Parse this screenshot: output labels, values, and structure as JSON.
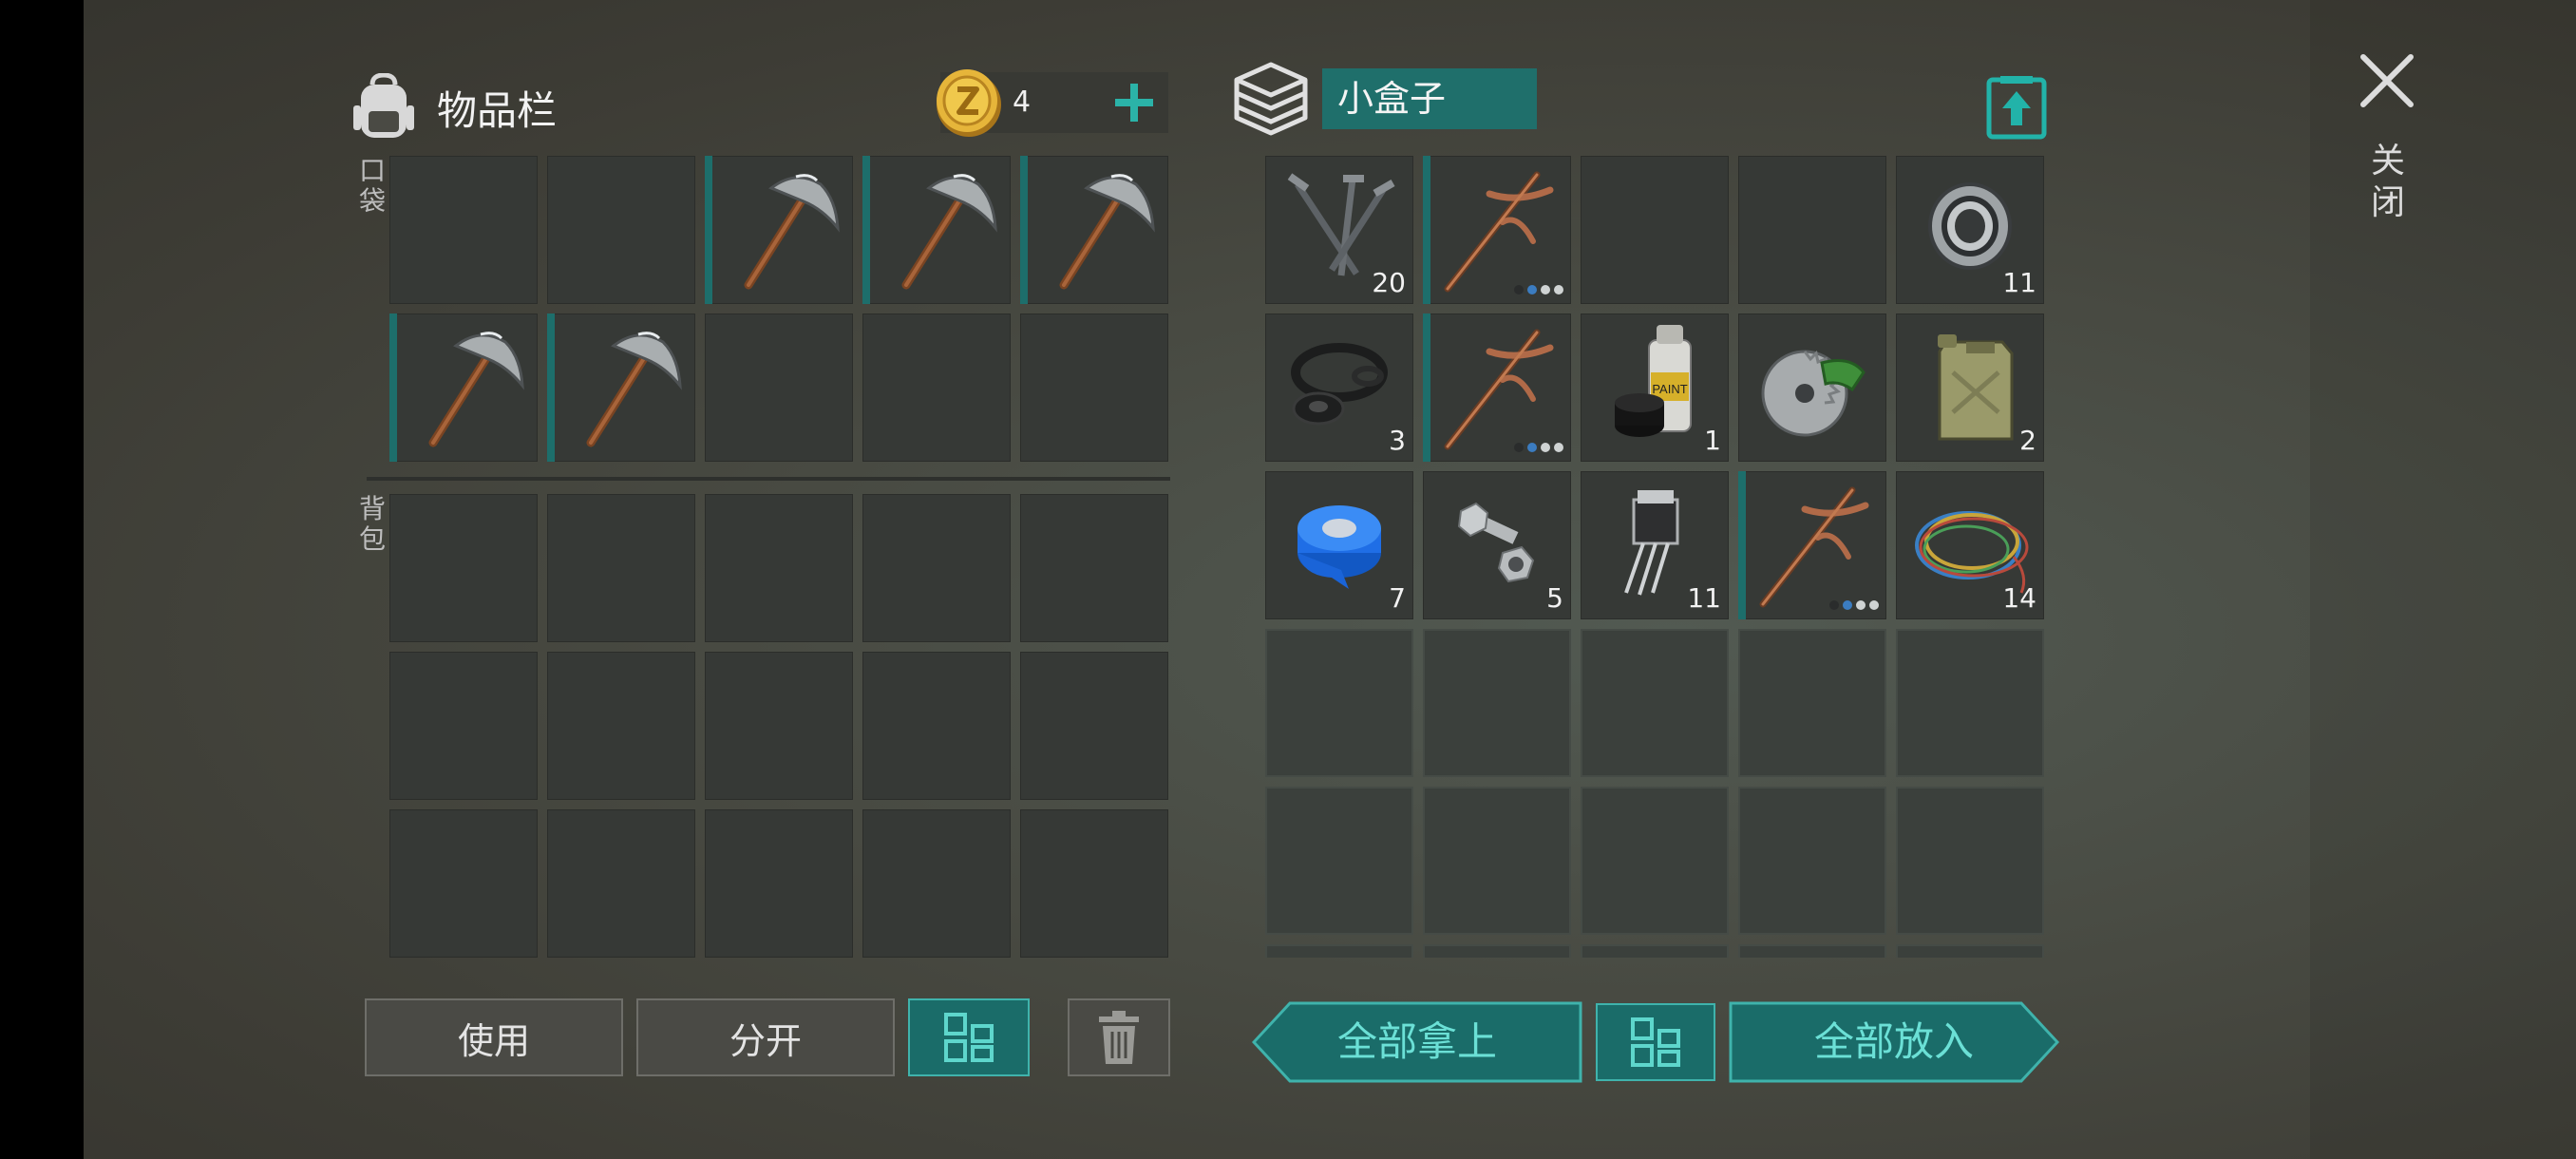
{
  "inventory": {
    "title": "物品栏",
    "coin_count": "4",
    "pocket_label": "口袋",
    "backpack_label": "背包",
    "pocket_slots": [
      {
        "item": "",
        "qty": ""
      },
      {
        "item": "",
        "qty": ""
      },
      {
        "item": "pickaxe",
        "qty": ""
      },
      {
        "item": "pickaxe",
        "qty": ""
      },
      {
        "item": "pickaxe",
        "qty": ""
      },
      {
        "item": "pickaxe",
        "qty": ""
      },
      {
        "item": "pickaxe",
        "qty": ""
      },
      {
        "item": "",
        "qty": ""
      },
      {
        "item": "",
        "qty": ""
      },
      {
        "item": "",
        "qty": ""
      }
    ],
    "backpack_rows": 3,
    "buttons": {
      "use": "使用",
      "split": "分开"
    }
  },
  "box": {
    "name": "小盒子",
    "slots": [
      {
        "item": "nails",
        "qty": "20"
      },
      {
        "item": "copper-pickaxe",
        "qty": "",
        "durability": 2
      },
      {
        "item": "",
        "qty": ""
      },
      {
        "item": "",
        "qty": ""
      },
      {
        "item": "bearing",
        "qty": "11"
      },
      {
        "item": "rubber-rings",
        "qty": "3"
      },
      {
        "item": "copper-pickaxe",
        "qty": "",
        "durability": 2
      },
      {
        "item": "spray-paint",
        "qty": "1",
        "label": "PAINT"
      },
      {
        "item": "saw-blade",
        "qty": ""
      },
      {
        "item": "jerry-can",
        "qty": "2"
      },
      {
        "item": "duct-tape",
        "qty": "7"
      },
      {
        "item": "bolt-nut",
        "qty": "5"
      },
      {
        "item": "transistor",
        "qty": "11"
      },
      {
        "item": "copper-pickaxe",
        "qty": "",
        "durability": 2
      },
      {
        "item": "wires",
        "qty": "14"
      }
    ],
    "empty_rows": 3,
    "buttons": {
      "take_all": "全部拿上",
      "put_all": "全部放入"
    }
  },
  "close_label": "关闭",
  "icons": {
    "backpack": "backpack-icon",
    "coin": "coin-icon",
    "add": "plus-icon",
    "box": "box-icon",
    "upload": "upload-icon",
    "close": "close-icon",
    "sort": "sort-grid-icon",
    "trash": "trash-icon"
  },
  "colors": {
    "accent": "#1f6f6b",
    "accent_light": "#3fb3ac",
    "text_teal": "#6be0d6"
  }
}
